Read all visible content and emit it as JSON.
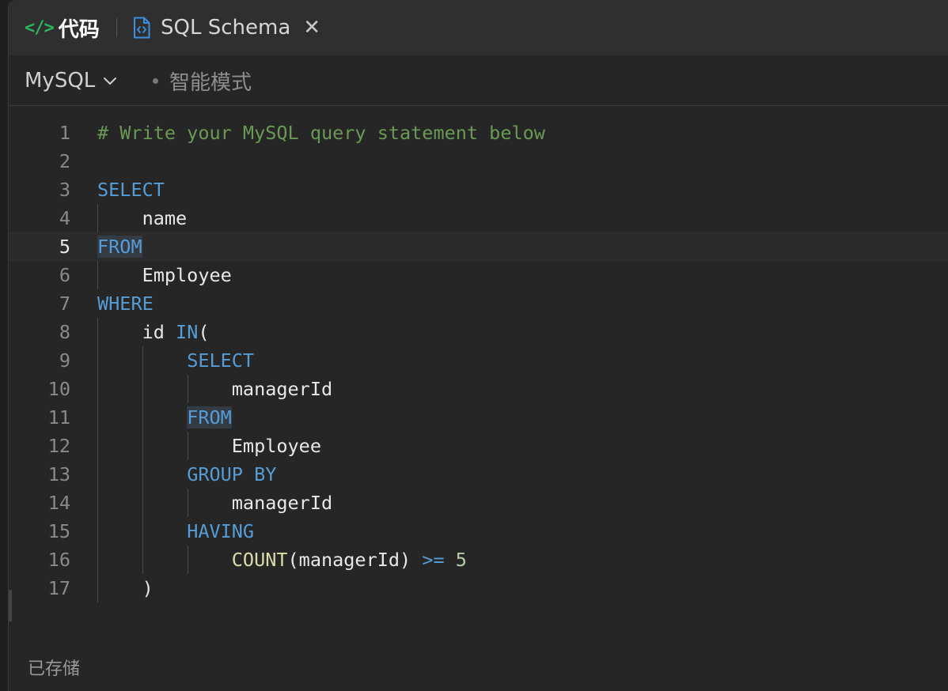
{
  "tabs": {
    "code": {
      "icon": "code-icon",
      "icon_glyph": "</>",
      "label": "代码"
    },
    "schema": {
      "icon": "file-code-icon",
      "label": "SQL Schema",
      "close_icon": "close-icon",
      "close_glyph": "✕"
    }
  },
  "toolbar": {
    "language": "MySQL",
    "language_icon": "chevron-down-icon",
    "mode": "智能模式"
  },
  "editor": {
    "current_line": 5,
    "lines": [
      {
        "n": "1",
        "tokens": [
          {
            "t": "# Write your MySQL query statement below",
            "k": "comment"
          }
        ]
      },
      {
        "n": "2",
        "tokens": []
      },
      {
        "n": "3",
        "tokens": [
          {
            "t": "SELECT",
            "k": "kw"
          }
        ]
      },
      {
        "n": "4",
        "tokens": [
          {
            "t": "    ",
            "k": "id"
          },
          {
            "t": "name",
            "k": "id"
          }
        ]
      },
      {
        "n": "5",
        "tokens": [
          {
            "t": "FROM",
            "k": "kw",
            "hl": true
          }
        ]
      },
      {
        "n": "6",
        "tokens": [
          {
            "t": "    ",
            "k": "id"
          },
          {
            "t": "Employee",
            "k": "id"
          }
        ]
      },
      {
        "n": "7",
        "tokens": [
          {
            "t": "WHERE",
            "k": "kw"
          }
        ]
      },
      {
        "n": "8",
        "tokens": [
          {
            "t": "    ",
            "k": "id"
          },
          {
            "t": "id ",
            "k": "id"
          },
          {
            "t": "IN",
            "k": "kw"
          },
          {
            "t": "(",
            "k": "id"
          }
        ]
      },
      {
        "n": "9",
        "tokens": [
          {
            "t": "        ",
            "k": "id"
          },
          {
            "t": "SELECT",
            "k": "kw"
          }
        ]
      },
      {
        "n": "10",
        "tokens": [
          {
            "t": "            ",
            "k": "id"
          },
          {
            "t": "managerId",
            "k": "id"
          }
        ]
      },
      {
        "n": "11",
        "tokens": [
          {
            "t": "        ",
            "k": "id"
          },
          {
            "t": "FROM",
            "k": "kw",
            "hl": true
          }
        ]
      },
      {
        "n": "12",
        "tokens": [
          {
            "t": "            ",
            "k": "id"
          },
          {
            "t": "Employee",
            "k": "id"
          }
        ]
      },
      {
        "n": "13",
        "tokens": [
          {
            "t": "        ",
            "k": "id"
          },
          {
            "t": "GROUP BY",
            "k": "kw"
          }
        ]
      },
      {
        "n": "14",
        "tokens": [
          {
            "t": "            ",
            "k": "id"
          },
          {
            "t": "managerId",
            "k": "id"
          }
        ]
      },
      {
        "n": "15",
        "tokens": [
          {
            "t": "        ",
            "k": "id"
          },
          {
            "t": "HAVING",
            "k": "kw"
          }
        ]
      },
      {
        "n": "16",
        "tokens": [
          {
            "t": "            ",
            "k": "id"
          },
          {
            "t": "COUNT",
            "k": "fn"
          },
          {
            "t": "(managerId) ",
            "k": "id"
          },
          {
            "t": ">=",
            "k": "op"
          },
          {
            "t": " ",
            "k": "id"
          },
          {
            "t": "5",
            "k": "num"
          }
        ]
      },
      {
        "n": "17",
        "tokens": [
          {
            "t": "    ",
            "k": "id"
          },
          {
            "t": ")",
            "k": "id"
          }
        ]
      }
    ]
  },
  "status": {
    "saved": "已存储"
  },
  "colors": {
    "keyword": "#569cd6",
    "comment": "#6a9955",
    "function": "#dcdcaa",
    "number": "#b5cea8",
    "code_icon": "#2db55d"
  }
}
